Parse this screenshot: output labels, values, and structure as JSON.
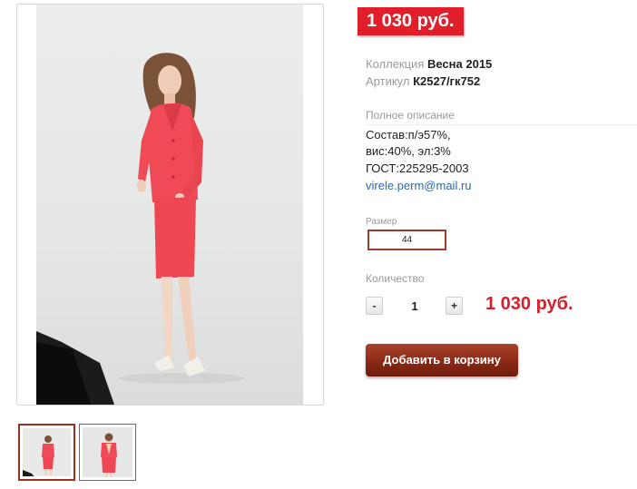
{
  "product": {
    "price_badge": "1 030 руб.",
    "collection_label": "Коллекция",
    "collection_value": "Весна 2015",
    "article_label": "Артикул",
    "article_value": "К2527/гк752"
  },
  "description": {
    "title": "Полное описание",
    "line1": "Состав:п/э57%,",
    "line2": "вис:40%, эл:3%",
    "line3": "ГОСТ:225295-2003",
    "email": "virele.perm@mail.ru"
  },
  "size": {
    "label": "Размер",
    "selected": "44"
  },
  "quantity": {
    "label": "Количество",
    "minus": "-",
    "plus": "+",
    "value": "1",
    "total": "1 030 руб."
  },
  "cart": {
    "add_label": "Добавить в корзину"
  },
  "colors": {
    "accent_red": "#e11f2b",
    "button_brown": "#8a2a17",
    "link_blue": "#2a6aad",
    "suit": "#ef4a56"
  }
}
